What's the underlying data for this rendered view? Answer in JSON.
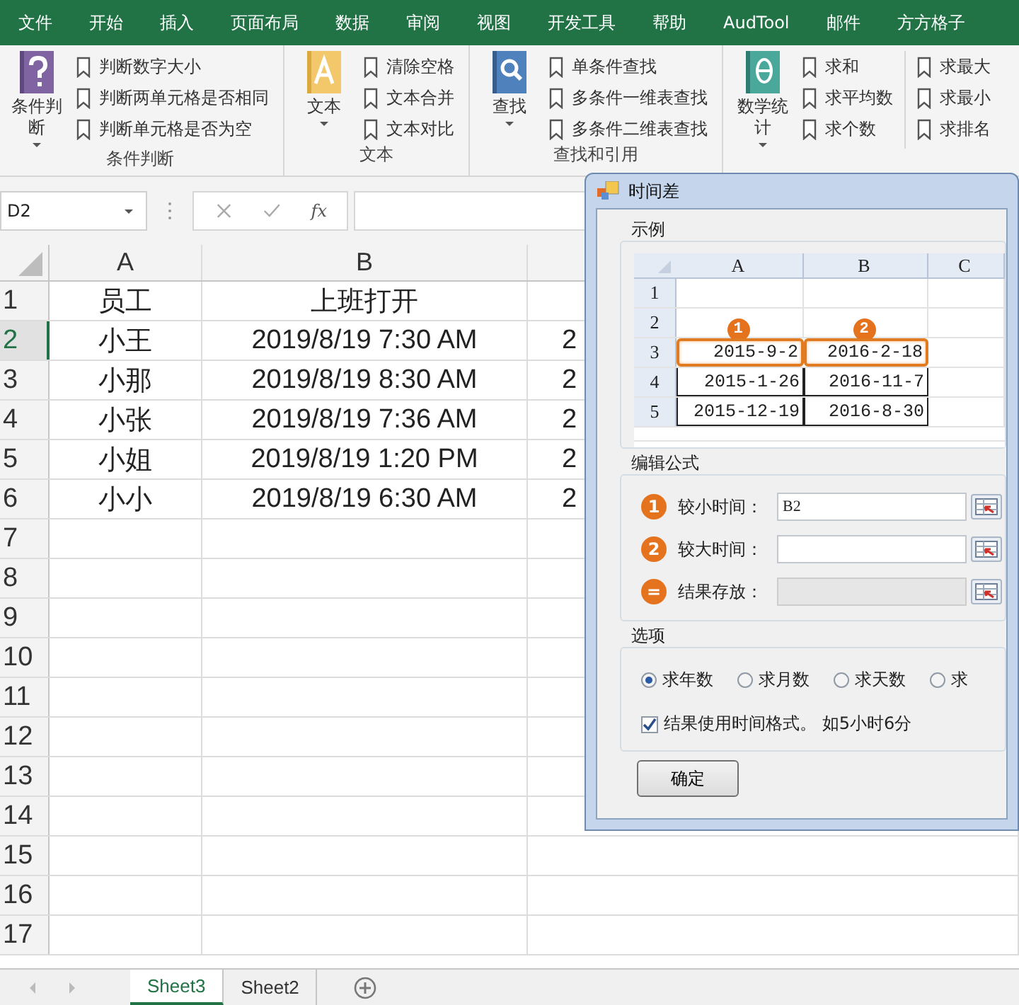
{
  "ribbon_tabs": [
    "文件",
    "开始",
    "插入",
    "页面布局",
    "数据",
    "审阅",
    "视图",
    "开发工具",
    "帮助",
    "AudTool",
    "邮件",
    "方方格子"
  ],
  "ribbon_groups": [
    {
      "label": "条件判断",
      "big_button": "条件判断",
      "items": [
        "判断数字大小",
        "判断两单元格是否相同",
        "判断单元格是否为空"
      ]
    },
    {
      "label": "文本",
      "big_button": "文本",
      "items": [
        "清除空格",
        "文本合并",
        "文本对比"
      ]
    },
    {
      "label": "查找和引用",
      "big_button": "查找",
      "items": [
        "单条件查找",
        "多条件一维表查找",
        "多条件二维表查找"
      ]
    },
    {
      "big_button": "数学统计",
      "items": [
        "求和",
        "求平均数",
        "求个数",
        "求最大",
        "求最小",
        "求排名"
      ]
    }
  ],
  "formula_bar": {
    "name_box": "D2",
    "function_label": "fx"
  },
  "sheet": {
    "columns": [
      "A",
      "B"
    ],
    "rows": [
      {
        "number": "1",
        "selected": false,
        "cells": [
          "员工",
          "上班打开"
        ]
      },
      {
        "number": "2",
        "selected": true,
        "cells": [
          "小王",
          "2019/8/19 7:30 AM",
          "2"
        ]
      },
      {
        "number": "3",
        "selected": false,
        "cells": [
          "小那",
          "2019/8/19 8:30 AM",
          "2"
        ]
      },
      {
        "number": "4",
        "selected": false,
        "cells": [
          "小张",
          "2019/8/19 7:36 AM",
          "2"
        ]
      },
      {
        "number": "5",
        "selected": false,
        "cells": [
          "小姐",
          "2019/8/19 1:20 PM",
          "2"
        ]
      },
      {
        "number": "6",
        "selected": false,
        "cells": [
          "小小",
          "2019/8/19 6:30 AM",
          "2"
        ]
      },
      {
        "number": "7",
        "selected": false
      },
      {
        "number": "8",
        "selected": false
      },
      {
        "number": "9",
        "selected": false
      },
      {
        "number": "10",
        "selected": false
      },
      {
        "number": "11",
        "selected": false
      },
      {
        "number": "12",
        "selected": false
      },
      {
        "number": "13",
        "selected": false
      },
      {
        "number": "14",
        "selected": false
      },
      {
        "number": "15",
        "selected": false
      },
      {
        "number": "16",
        "selected": false
      },
      {
        "number": "17",
        "selected": false
      }
    ]
  },
  "sheet_tabs": [
    {
      "label": "Sheet3",
      "selected": true
    },
    {
      "label": "Sheet2",
      "selected": false
    }
  ],
  "dialog": {
    "title": "时间差",
    "example": {
      "label": "示例",
      "columns": [
        "A",
        "B",
        "C"
      ],
      "markers": [
        "1",
        "2"
      ],
      "rows": [
        {
          "number": "1",
          "highlighted": false
        },
        {
          "number": "2",
          "highlighted": false
        },
        {
          "number": "3",
          "highlighted": true,
          "cells": [
            "2015-9-2",
            "2016-2-18"
          ]
        },
        {
          "number": "4",
          "highlighted": false,
          "cells": [
            "2015-1-26",
            "2016-11-7"
          ]
        },
        {
          "number": "5",
          "highlighted": false,
          "cells": [
            "2015-12-19",
            "2016-8-30"
          ]
        }
      ]
    },
    "formula": {
      "label": "编辑公式",
      "fields": [
        {
          "badge": "1",
          "label": "较小时间：",
          "value": "B2",
          "disabled": false
        },
        {
          "badge": "2",
          "label": "较大时间：",
          "disabled": false
        },
        {
          "badge": "=",
          "label": "结果存放：",
          "disabled": true
        }
      ]
    },
    "options": {
      "label": "选项",
      "radios": [
        {
          "label": "求年数",
          "selected": true
        },
        {
          "label": "求月数",
          "selected": false
        },
        {
          "label": "求天数",
          "selected": false
        },
        {
          "label": "求",
          "selected": false
        }
      ],
      "checkbox": {
        "label": "结果使用时间格式。 如5小时6分",
        "checked": true
      }
    },
    "ok_button": "确定"
  }
}
